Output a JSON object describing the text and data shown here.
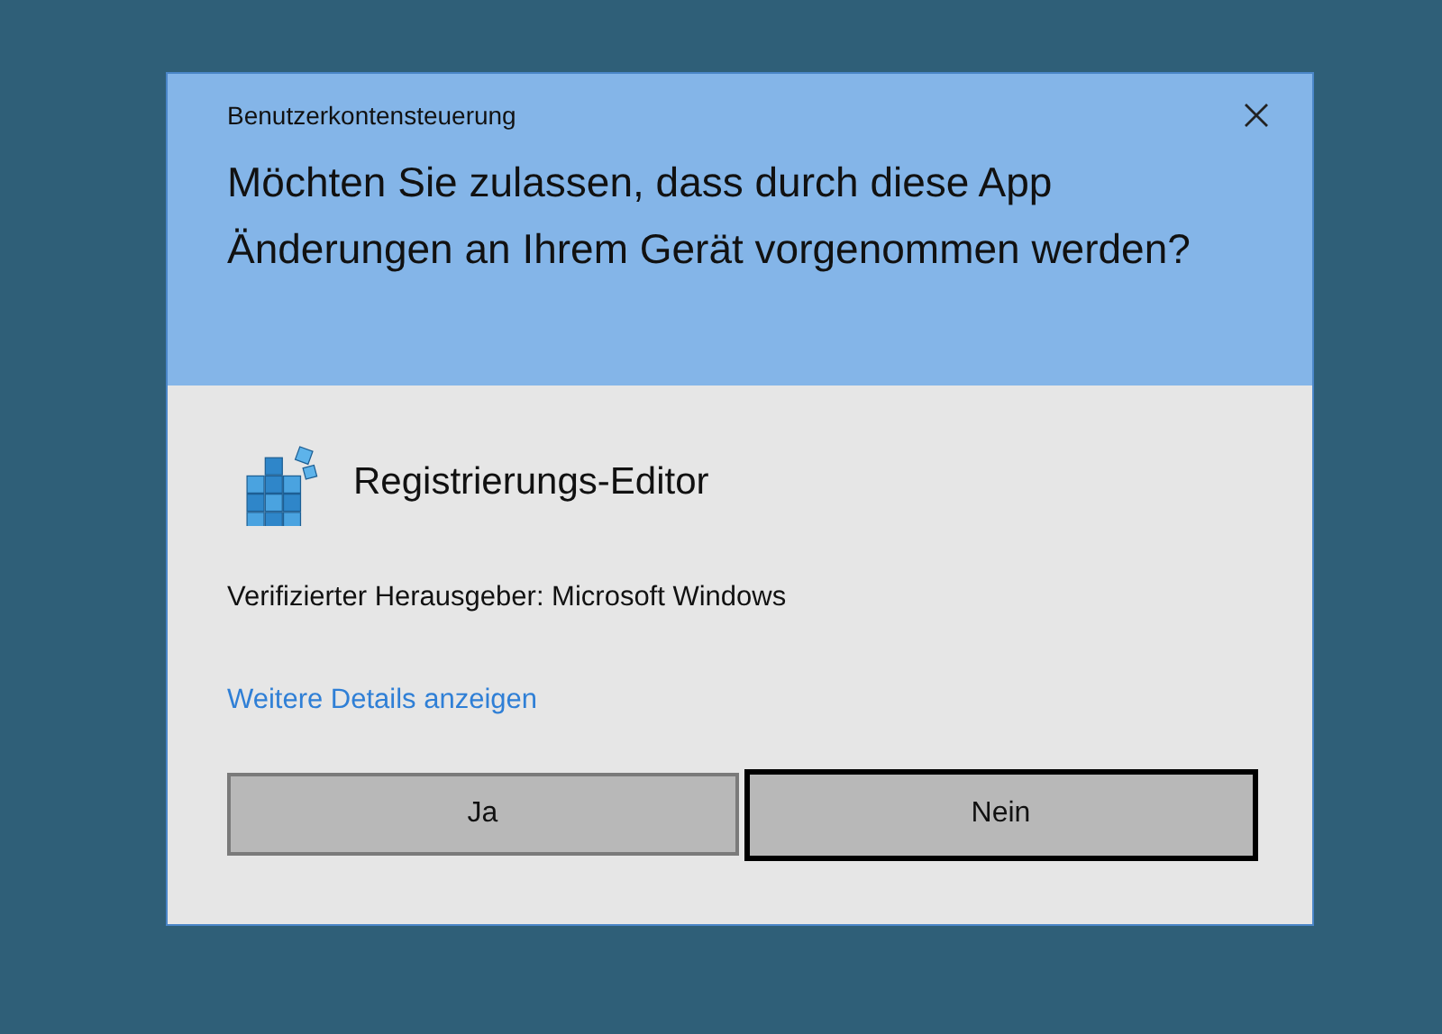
{
  "window": {
    "title": "Benutzerkontensteuerung"
  },
  "question": "Möchten Sie zulassen, dass durch diese App Änderungen an Ihrem Gerät vorgenommen werden?",
  "app": {
    "name": "Registrierungs-Editor"
  },
  "publisher": "Verifizierter Herausgeber: Microsoft Windows",
  "details_link": "Weitere Details anzeigen",
  "buttons": [
    {
      "label": "Ja",
      "focused": false
    },
    {
      "label": "Nein",
      "focused": true
    }
  ]
}
